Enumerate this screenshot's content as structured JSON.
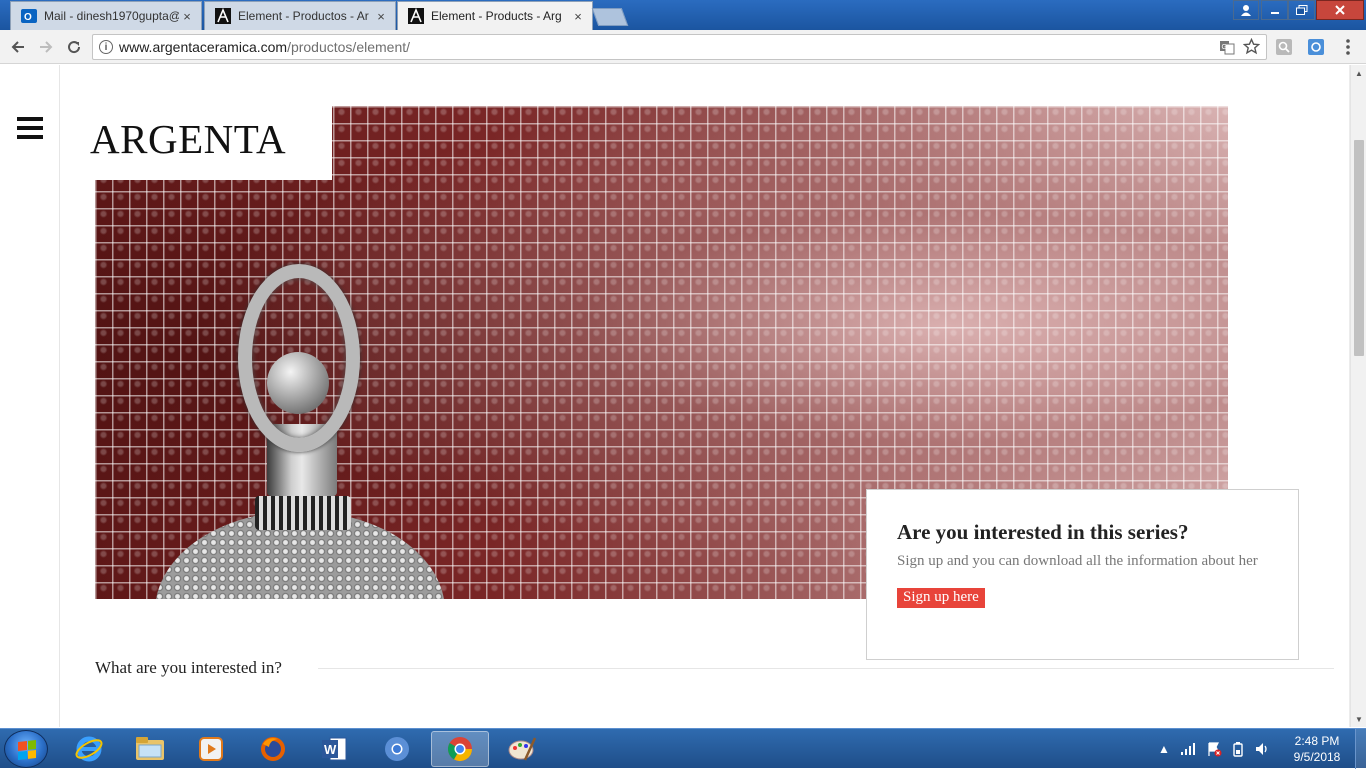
{
  "browser": {
    "tabs": [
      {
        "title": "Mail - dinesh1970gupta@",
        "icon": "outlook-icon",
        "active": false
      },
      {
        "title": "Element - Productos - Ar",
        "icon": "argenta-icon",
        "active": false
      },
      {
        "title": "Element - Products - Arg",
        "icon": "argenta-icon",
        "active": true
      }
    ],
    "close_glyph": "×",
    "url_host": "www.argentaceramica.com",
    "url_path": "/productos/element/",
    "info_glyph": "i"
  },
  "page": {
    "logo_text": "ARGENTA",
    "hero_image": "red-mosaic-tiles-with-silver-ornament",
    "cta": {
      "title": "Are you interested in this series?",
      "text": "Sign up and you can download all the information about her",
      "button_label": "Sign up here",
      "button_color": "#e8443a"
    },
    "interest_label": "What are you interested in?"
  },
  "taskbar": {
    "apps": [
      "internet-explorer-icon",
      "file-explorer-icon",
      "media-player-icon",
      "firefox-icon",
      "word-icon",
      "chrome-icon",
      "chrome-icon",
      "paint-icon"
    ],
    "active_app": "chrome-icon",
    "clock_time": "2:48 PM",
    "clock_date": "9/5/2018"
  }
}
